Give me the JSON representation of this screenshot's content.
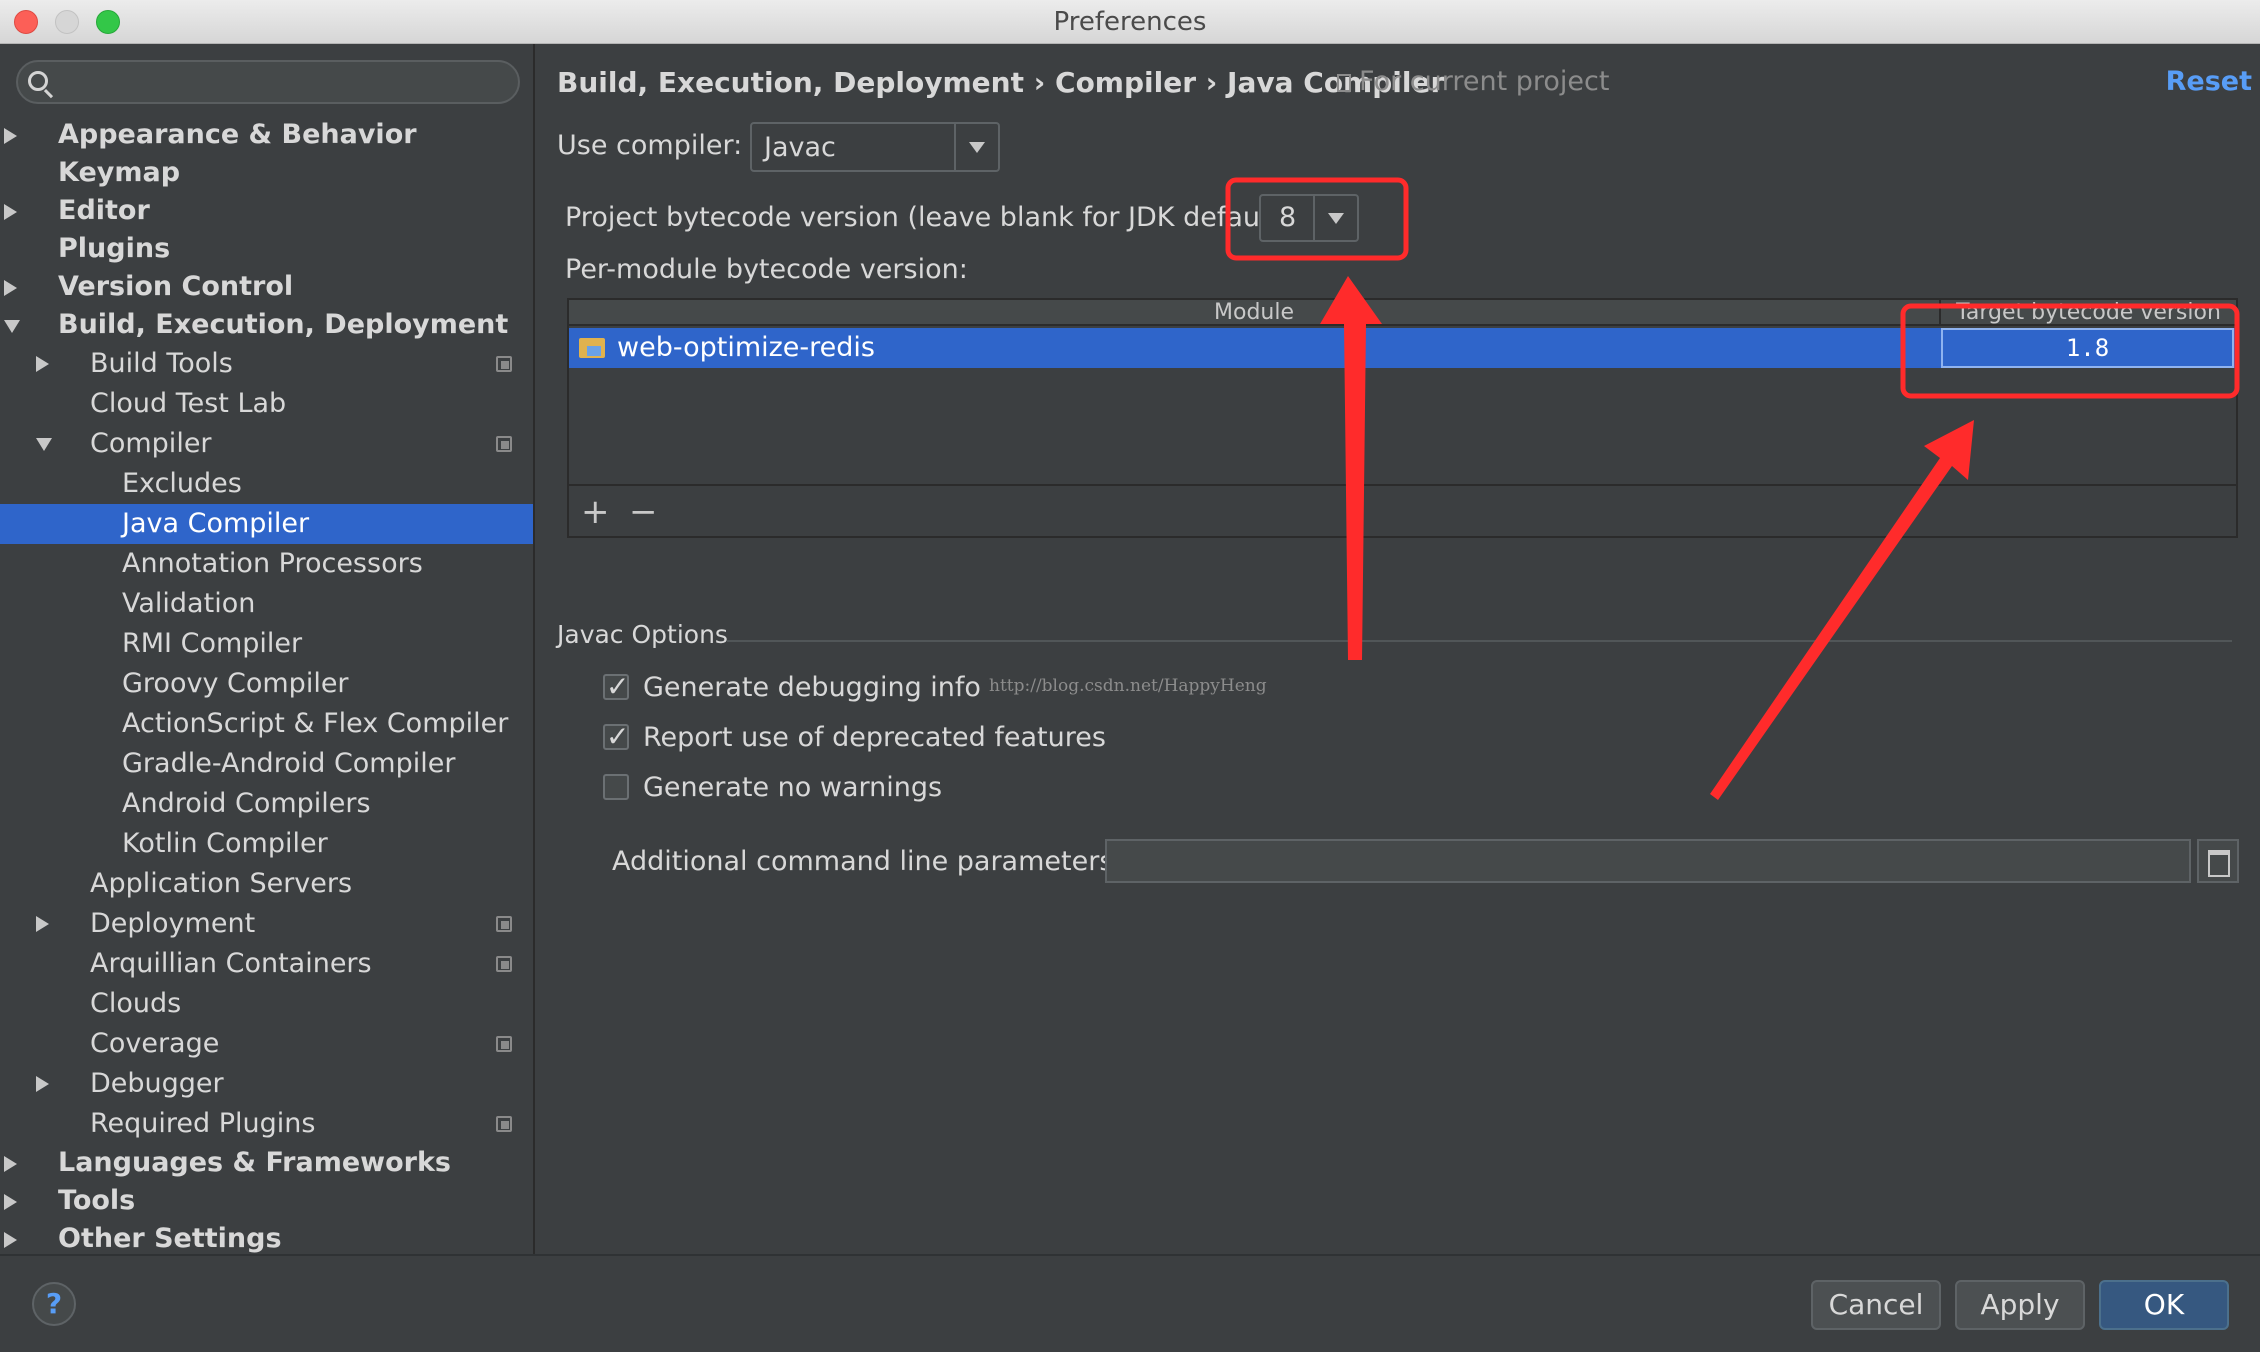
{
  "window": {
    "title": "Preferences"
  },
  "search": {
    "placeholder": ""
  },
  "sidebar": {
    "items": [
      {
        "label": "Appearance & Behavior",
        "level": 0,
        "arrow": "right"
      },
      {
        "label": "Keymap",
        "level": 0,
        "arrow": "none"
      },
      {
        "label": "Editor",
        "level": 0,
        "arrow": "right"
      },
      {
        "label": "Plugins",
        "level": 0,
        "arrow": "none"
      },
      {
        "label": "Version Control",
        "level": 0,
        "arrow": "right"
      },
      {
        "label": "Build, Execution, Deployment",
        "level": 0,
        "arrow": "down"
      },
      {
        "label": "Build Tools",
        "level": 1,
        "arrow": "right",
        "project": true
      },
      {
        "label": "Cloud Test Lab",
        "level": 1,
        "arrow": "none"
      },
      {
        "label": "Compiler",
        "level": 1,
        "arrow": "down",
        "project": true
      },
      {
        "label": "Excludes",
        "level": 2,
        "arrow": "none"
      },
      {
        "label": "Java Compiler",
        "level": 2,
        "arrow": "none",
        "selected": true
      },
      {
        "label": "Annotation Processors",
        "level": 2,
        "arrow": "none"
      },
      {
        "label": "Validation",
        "level": 2,
        "arrow": "none"
      },
      {
        "label": "RMI Compiler",
        "level": 2,
        "arrow": "none"
      },
      {
        "label": "Groovy Compiler",
        "level": 2,
        "arrow": "none"
      },
      {
        "label": "ActionScript & Flex Compiler",
        "level": 2,
        "arrow": "none"
      },
      {
        "label": "Gradle-Android Compiler",
        "level": 2,
        "arrow": "none"
      },
      {
        "label": "Android Compilers",
        "level": 2,
        "arrow": "none"
      },
      {
        "label": "Kotlin Compiler",
        "level": 2,
        "arrow": "none"
      },
      {
        "label": "Application Servers",
        "level": 1,
        "arrow": "none"
      },
      {
        "label": "Deployment",
        "level": 1,
        "arrow": "right",
        "project": true
      },
      {
        "label": "Arquillian Containers",
        "level": 1,
        "arrow": "none",
        "project": true
      },
      {
        "label": "Clouds",
        "level": 1,
        "arrow": "none"
      },
      {
        "label": "Coverage",
        "level": 1,
        "arrow": "none",
        "project": true
      },
      {
        "label": "Debugger",
        "level": 1,
        "arrow": "right"
      },
      {
        "label": "Required Plugins",
        "level": 1,
        "arrow": "none",
        "project": true
      },
      {
        "label": "Languages & Frameworks",
        "level": 0,
        "arrow": "right"
      },
      {
        "label": "Tools",
        "level": 0,
        "arrow": "right"
      },
      {
        "label": "Other Settings",
        "level": 0,
        "arrow": "right"
      }
    ]
  },
  "header": {
    "breadcrumb": "Build, Execution, Deployment › Compiler › Java Compiler",
    "scope": "For current project",
    "reset": "Reset"
  },
  "compiler": {
    "use_label": "Use compiler:",
    "use_value": "Javac",
    "bytecode_label": "Project bytecode version (leave blank for JDK default):",
    "bytecode_value": "8",
    "per_module_label": "Per-module bytecode version:"
  },
  "modules_table": {
    "columns": [
      "Module",
      "Target bytecode version"
    ],
    "rows": [
      {
        "module": "web-optimize-redis",
        "target": "1.8"
      }
    ],
    "add": "+",
    "remove": "−"
  },
  "javac": {
    "section": "Javac Options",
    "options": [
      {
        "label": "Generate debugging info",
        "checked": true
      },
      {
        "label": "Report use of deprecated features",
        "checked": true
      },
      {
        "label": "Generate no warnings",
        "checked": false
      }
    ],
    "params_label": "Additional command line parameters:",
    "params_value": ""
  },
  "watermark": "http://blog.csdn.net/HappyHeng",
  "footer": {
    "help": "?",
    "cancel": "Cancel",
    "apply": "Apply",
    "ok": "OK"
  },
  "colors": {
    "accent": "#2f65ca",
    "annotation": "#ff2b2b",
    "link": "#589df6"
  }
}
